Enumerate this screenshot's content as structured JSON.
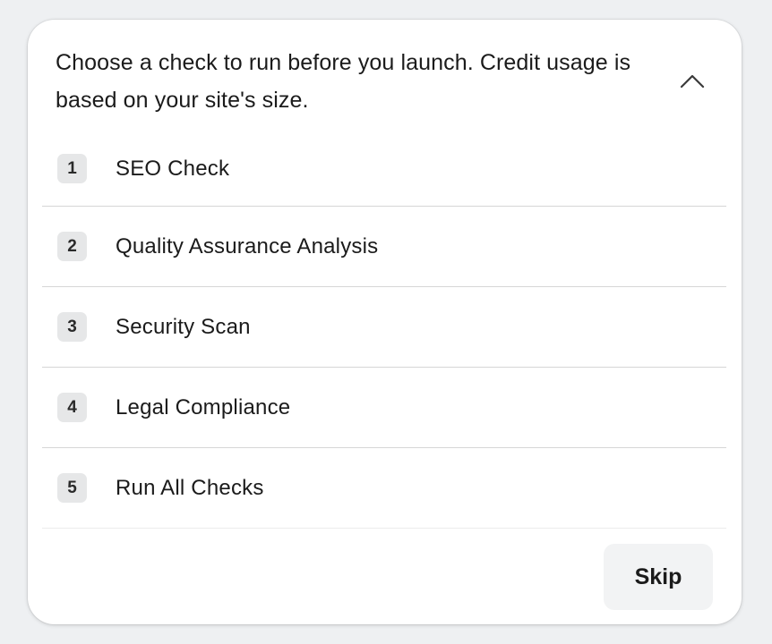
{
  "dialog": {
    "description": "Choose a check to run before you launch. Credit usage is based on your site's size.",
    "collapse_icon": "chevron-up-icon"
  },
  "checks": [
    {
      "number": "1",
      "label": "SEO Check"
    },
    {
      "number": "2",
      "label": "Quality Assurance Analysis"
    },
    {
      "number": "3",
      "label": "Security Scan"
    },
    {
      "number": "4",
      "label": "Legal Compliance"
    },
    {
      "number": "5",
      "label": "Run All Checks"
    }
  ],
  "footer": {
    "skip_label": "Skip"
  },
  "colors": {
    "background": "#eef0f2",
    "panel": "#ffffff",
    "badge": "#e6e7e8",
    "divider": "#d6d6d6",
    "skip_button": "#f2f3f4",
    "text": "#1b1b1b"
  }
}
